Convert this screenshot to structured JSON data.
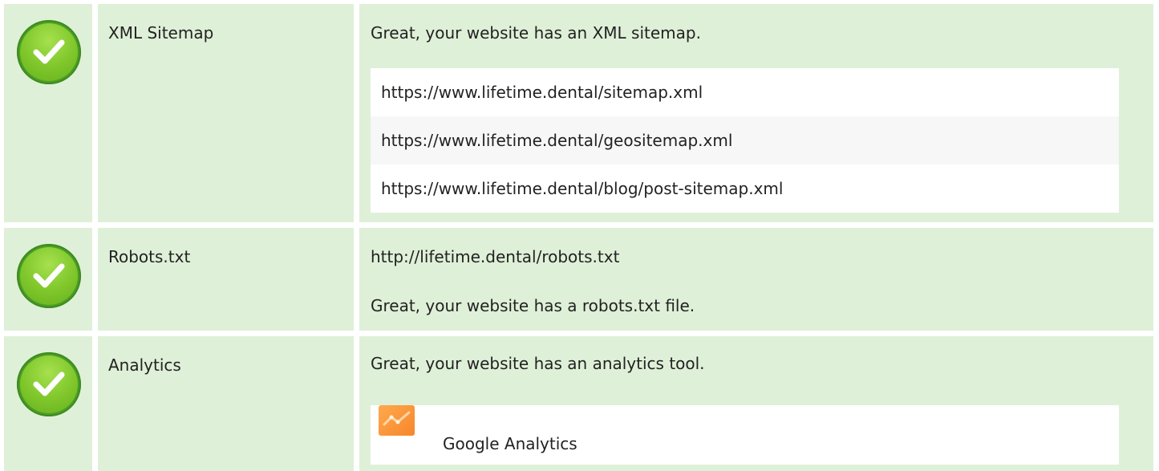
{
  "colors": {
    "row_background": "#dff0d8",
    "check_icon": "#7ec62a",
    "analytics_icon": "#f7862b"
  },
  "rows": [
    {
      "status_icon": "check-icon",
      "name": "XML Sitemap",
      "message": "Great, your website has an XML sitemap.",
      "items": [
        "https://www.lifetime.dental/sitemap.xml",
        "https://www.lifetime.dental/geositemap.xml",
        "https://www.lifetime.dental/blog/post-sitemap.xml"
      ]
    },
    {
      "status_icon": "check-icon",
      "name": "Robots.txt",
      "url": "http://lifetime.dental/robots.txt",
      "message": "Great, your website has a robots.txt file."
    },
    {
      "status_icon": "check-icon",
      "name": "Analytics",
      "message": "Great, your website has an analytics tool.",
      "tool": {
        "icon": "google-analytics-icon",
        "name": "Google Analytics"
      }
    }
  ]
}
